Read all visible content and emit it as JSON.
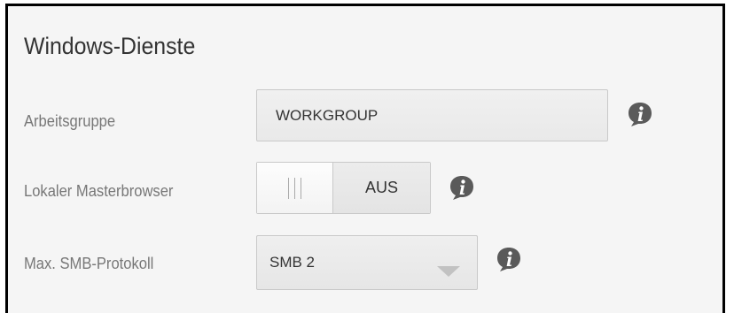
{
  "section": {
    "title": "Windows-Dienste"
  },
  "workgroup": {
    "label": "Arbeitsgruppe",
    "value": "WORKGROUP",
    "info_icon": "info-icon"
  },
  "master_browser": {
    "label": "Lokaler Masterbrowser",
    "state": "AUS",
    "handle_icon": "grip-lines-icon",
    "info_icon": "info-icon"
  },
  "smb_protocol": {
    "label": "Max. SMB-Protokoll",
    "selected": "SMB 2",
    "dropdown_icon": "chevron-down-icon",
    "info_icon": "info-icon"
  },
  "colors": {
    "panel_background": "#f5f5f5",
    "title_text": "#333333",
    "label_text": "#777777",
    "info_icon": "#5a5a5a",
    "border": "#c9c9c9"
  }
}
